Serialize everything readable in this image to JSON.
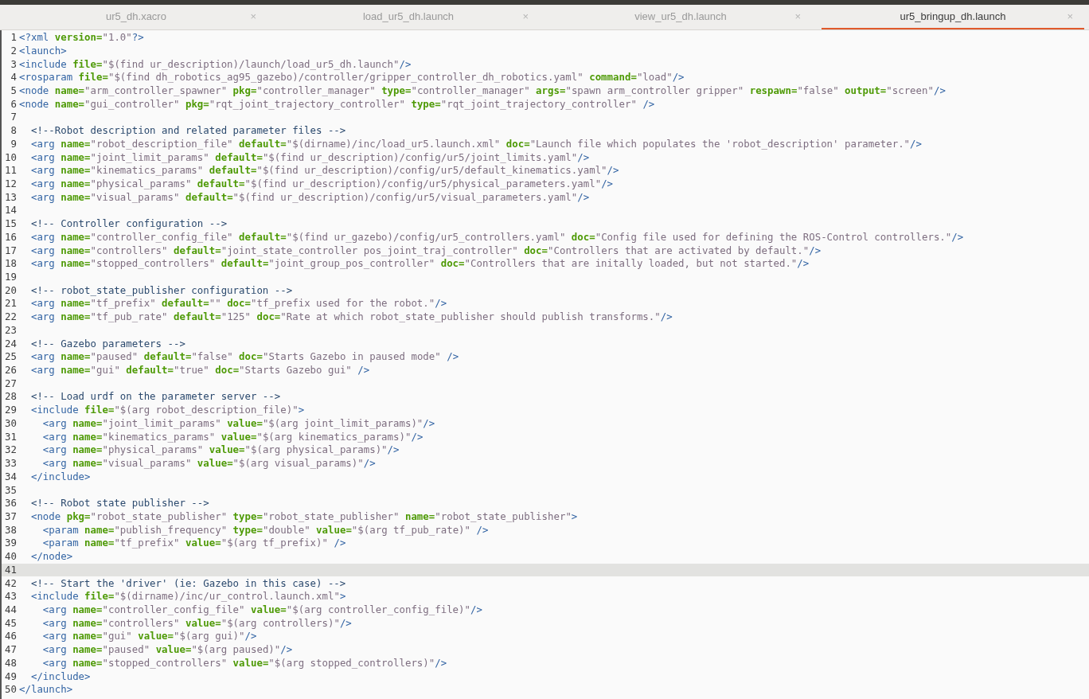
{
  "tabs": [
    {
      "label": "ur5_dh.xacro",
      "close": "×",
      "selected": false
    },
    {
      "label": "load_ur5_dh.launch",
      "close": "×",
      "selected": false
    },
    {
      "label": "view_ur5_dh.launch",
      "close": "×",
      "selected": false
    },
    {
      "label": "ur5_bringup_dh.launch",
      "close": "×",
      "selected": true
    }
  ],
  "lines": [
    {
      "number": "1",
      "text": "<?xml version=\"1.0\"?>",
      "current": false
    },
    {
      "number": "2",
      "text": "<launch>",
      "current": false
    },
    {
      "number": "3",
      "text": "<include file=\"$(find ur_description)/launch/load_ur5_dh.launch\"/>",
      "current": false
    },
    {
      "number": "4",
      "text": "<rosparam file=\"$(find dh_robotics_ag95_gazebo)/controller/gripper_controller_dh_robotics.yaml\" command=\"load\"/>",
      "current": false
    },
    {
      "number": "5",
      "text": "<node name=\"arm_controller_spawner\" pkg=\"controller_manager\" type=\"controller_manager\" args=\"spawn arm_controller gripper\" respawn=\"false\" output=\"screen\"/>",
      "current": false
    },
    {
      "number": "6",
      "text": "<node name=\"gui_controller\" pkg=\"rqt_joint_trajectory_controller\" type=\"rqt_joint_trajectory_controller\" />",
      "current": false
    },
    {
      "number": "7",
      "current": false
    },
    {
      "number": "8",
      "text": "  <!--Robot description and related parameter files -->",
      "current": false
    },
    {
      "number": "9",
      "text": "  <arg name=\"robot_description_file\" default=\"$(dirname)/inc/load_ur5.launch.xml\" doc=\"Launch file which populates the 'robot_description' parameter.\"/>",
      "current": false
    },
    {
      "number": "10",
      "text": "  <arg name=\"joint_limit_params\" default=\"$(find ur_description)/config/ur5/joint_limits.yaml\"/>",
      "current": false
    },
    {
      "number": "11",
      "text": "  <arg name=\"kinematics_params\" default=\"$(find ur_description)/config/ur5/default_kinematics.yaml\"/>",
      "current": false
    },
    {
      "number": "12",
      "text": "  <arg name=\"physical_params\" default=\"$(find ur_description)/config/ur5/physical_parameters.yaml\"/>",
      "current": false
    },
    {
      "number": "13",
      "text": "  <arg name=\"visual_params\" default=\"$(find ur_description)/config/ur5/visual_parameters.yaml\"/>",
      "current": false
    },
    {
      "number": "14",
      "current": false
    },
    {
      "number": "15",
      "text": "  <!-- Controller configuration -->",
      "current": false
    },
    {
      "number": "16",
      "text": "  <arg name=\"controller_config_file\" default=\"$(find ur_gazebo)/config/ur5_controllers.yaml\" doc=\"Config file used for defining the ROS-Control controllers.\"/>",
      "current": false
    },
    {
      "number": "17",
      "text": "  <arg name=\"controllers\" default=\"joint_state_controller pos_joint_traj_controller\" doc=\"Controllers that are activated by default.\"/>",
      "current": false
    },
    {
      "number": "18",
      "text": "  <arg name=\"stopped_controllers\" default=\"joint_group_pos_controller\" doc=\"Controllers that are initally loaded, but not started.\"/>",
      "current": false
    },
    {
      "number": "19",
      "current": false
    },
    {
      "number": "20",
      "text": "  <!-- robot_state_publisher configuration -->",
      "current": false
    },
    {
      "number": "21",
      "text": "  <arg name=\"tf_prefix\" default=\"\" doc=\"tf_prefix used for the robot.\"/>",
      "current": false
    },
    {
      "number": "22",
      "text": "  <arg name=\"tf_pub_rate\" default=\"125\" doc=\"Rate at which robot_state_publisher should publish transforms.\"/>",
      "current": false
    },
    {
      "number": "23",
      "current": false
    },
    {
      "number": "24",
      "text": "  <!-- Gazebo parameters -->",
      "current": false
    },
    {
      "number": "25",
      "text": "  <arg name=\"paused\" default=\"false\" doc=\"Starts Gazebo in paused mode\" />",
      "current": false
    },
    {
      "number": "26",
      "text": "  <arg name=\"gui\" default=\"true\" doc=\"Starts Gazebo gui\" />",
      "current": false
    },
    {
      "number": "27",
      "current": false
    },
    {
      "number": "28",
      "text": "  <!-- Load urdf on the parameter server -->",
      "current": false
    },
    {
      "number": "29",
      "text": "  <include file=\"$(arg robot_description_file)\">",
      "current": false
    },
    {
      "number": "30",
      "text": "    <arg name=\"joint_limit_params\" value=\"$(arg joint_limit_params)\"/>",
      "current": false
    },
    {
      "number": "31",
      "text": "    <arg name=\"kinematics_params\" value=\"$(arg kinematics_params)\"/>",
      "current": false
    },
    {
      "number": "32",
      "text": "    <arg name=\"physical_params\" value=\"$(arg physical_params)\"/>",
      "current": false
    },
    {
      "number": "33",
      "text": "    <arg name=\"visual_params\" value=\"$(arg visual_params)\"/>",
      "current": false
    },
    {
      "number": "34",
      "text": "  </include>",
      "current": false
    },
    {
      "number": "35",
      "current": false
    },
    {
      "number": "36",
      "text": "  <!-- Robot state publisher -->",
      "current": false
    },
    {
      "number": "37",
      "text": "  <node pkg=\"robot_state_publisher\" type=\"robot_state_publisher\" name=\"robot_state_publisher\">",
      "current": false
    },
    {
      "number": "38",
      "text": "    <param name=\"publish_frequency\" type=\"double\" value=\"$(arg tf_pub_rate)\" />",
      "current": false
    },
    {
      "number": "39",
      "text": "    <param name=\"tf_prefix\" value=\"$(arg tf_prefix)\" />",
      "current": false
    },
    {
      "number": "40",
      "text": "  </node>",
      "current": false
    },
    {
      "number": "41",
      "current": true
    },
    {
      "number": "42",
      "text": "  <!-- Start the 'driver' (ie: Gazebo in this case) -->",
      "current": false
    },
    {
      "number": "43",
      "text": "  <include file=\"$(dirname)/inc/ur_control.launch.xml\">",
      "current": false
    },
    {
      "number": "44",
      "text": "    <arg name=\"controller_config_file\" value=\"$(arg controller_config_file)\"/>",
      "current": false
    },
    {
      "number": "45",
      "text": "    <arg name=\"controllers\" value=\"$(arg controllers)\"/>",
      "current": false
    },
    {
      "number": "46",
      "text": "    <arg name=\"gui\" value=\"$(arg gui)\"/>",
      "current": false
    },
    {
      "number": "47",
      "text": "    <arg name=\"paused\" value=\"$(arg paused)\"/>",
      "current": false
    },
    {
      "number": "48",
      "text": "    <arg name=\"stopped_controllers\" value=\"$(arg stopped_controllers)\"/>",
      "current": false
    },
    {
      "number": "49",
      "text": "  </include>",
      "current": false
    },
    {
      "number": "50",
      "text": "</launch>",
      "current": false
    }
  ]
}
